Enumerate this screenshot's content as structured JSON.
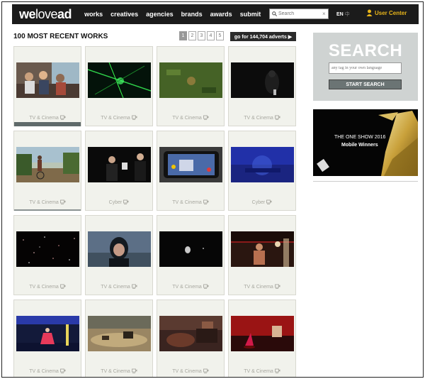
{
  "header": {
    "logo_bold_1": "we",
    "logo_light": "love",
    "logo_bold_2": "ad",
    "nav": [
      "works",
      "creatives",
      "agencies",
      "brands",
      "awards",
      "submit"
    ],
    "search_placeholder": "Search",
    "search_clear": "×",
    "lang_en": "EN",
    "lang_zh": "中",
    "user_center": "User Center"
  },
  "main": {
    "title": "100 MOST RECENT WORKS",
    "pages": [
      "1",
      "2",
      "3",
      "4",
      "5"
    ],
    "goto_label": "go for 144,704 adverts ▶"
  },
  "cards": [
    {
      "category": "TV & Cinema",
      "theme": "family"
    },
    {
      "category": "TV & Cinema",
      "theme": "green-lights"
    },
    {
      "category": "TV & Cinema",
      "theme": "grass"
    },
    {
      "category": "TV & Cinema",
      "theme": "dark-figure"
    },
    {
      "category": "TV & Cinema",
      "theme": "bike"
    },
    {
      "category": "Cyber",
      "theme": "men-dark"
    },
    {
      "category": "TV & Cinema",
      "theme": "phone"
    },
    {
      "category": "Cyber",
      "theme": "blue-haze"
    },
    {
      "category": "TV & Cinema",
      "theme": "stars"
    },
    {
      "category": "TV & Cinema",
      "theme": "diver"
    },
    {
      "category": "TV & Cinema",
      "theme": "dark-face"
    },
    {
      "category": "TV & Cinema",
      "theme": "boxing"
    },
    {
      "category": "TV & Cinema",
      "theme": "neon-dance"
    },
    {
      "category": "TV & Cinema",
      "theme": "desert"
    },
    {
      "category": "TV & Cinema",
      "theme": "car-interior"
    },
    {
      "category": "TV & Cinema",
      "theme": "red-stage"
    }
  ],
  "sidebar": {
    "search_title": "SEARCH",
    "search_placeholder": "any tag in your own language",
    "search_button": "START SEARCH",
    "ad_line1": "THE ONE SHOW 2016",
    "ad_line2": "Mobile Winners"
  }
}
